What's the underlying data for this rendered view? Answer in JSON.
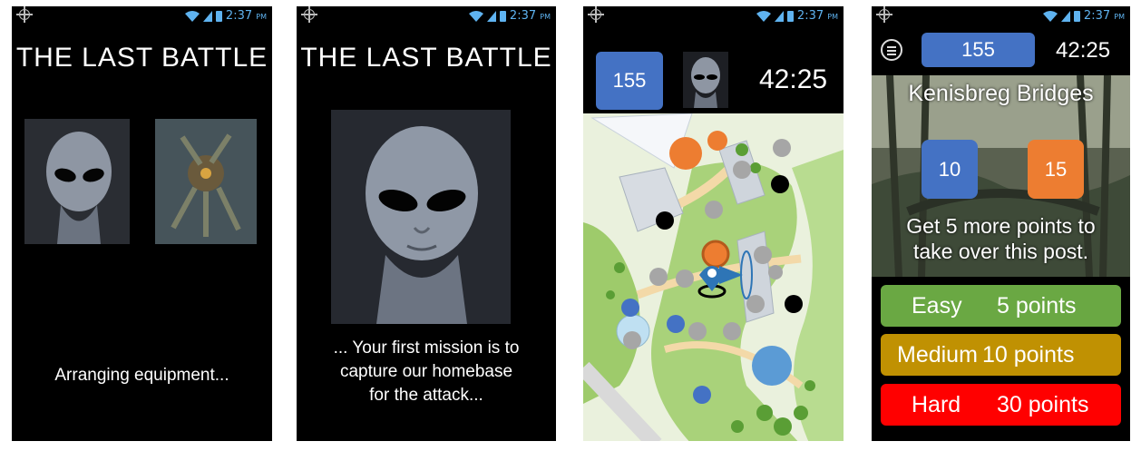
{
  "status": {
    "time": "2:37",
    "ampm": "PM"
  },
  "screen1": {
    "title": "THE LAST BATTLE",
    "message": "Arranging equipment..."
  },
  "screen2": {
    "title": "THE LAST BATTLE",
    "message_line1": "... Your first mission is to",
    "message_line2": "capture our homebase",
    "message_line3": "for the attack..."
  },
  "screen3": {
    "score": "155",
    "timer": "42:25"
  },
  "screen4": {
    "score": "155",
    "timer": "42:25",
    "location": "Kenisbreg Bridges",
    "blue_team_points": "10",
    "orange_team_points": "15",
    "hint_line1": "Get 5 more points to",
    "hint_line2": "take over this post.",
    "options": [
      {
        "level": "Easy",
        "points": "5 points",
        "color": "#6aa843"
      },
      {
        "level": "Medium",
        "points": "10 points",
        "color": "#c09102"
      },
      {
        "level": "Hard",
        "points": "30 points",
        "color": "#ff0000"
      }
    ]
  },
  "colors": {
    "blue": "#4472c4",
    "orange": "#ed7d31",
    "status": "#5fb3f0"
  },
  "icons": [
    "gps-icon",
    "wifi-icon",
    "signal-icon",
    "battery-icon",
    "menu-icon",
    "location-pin-icon"
  ]
}
